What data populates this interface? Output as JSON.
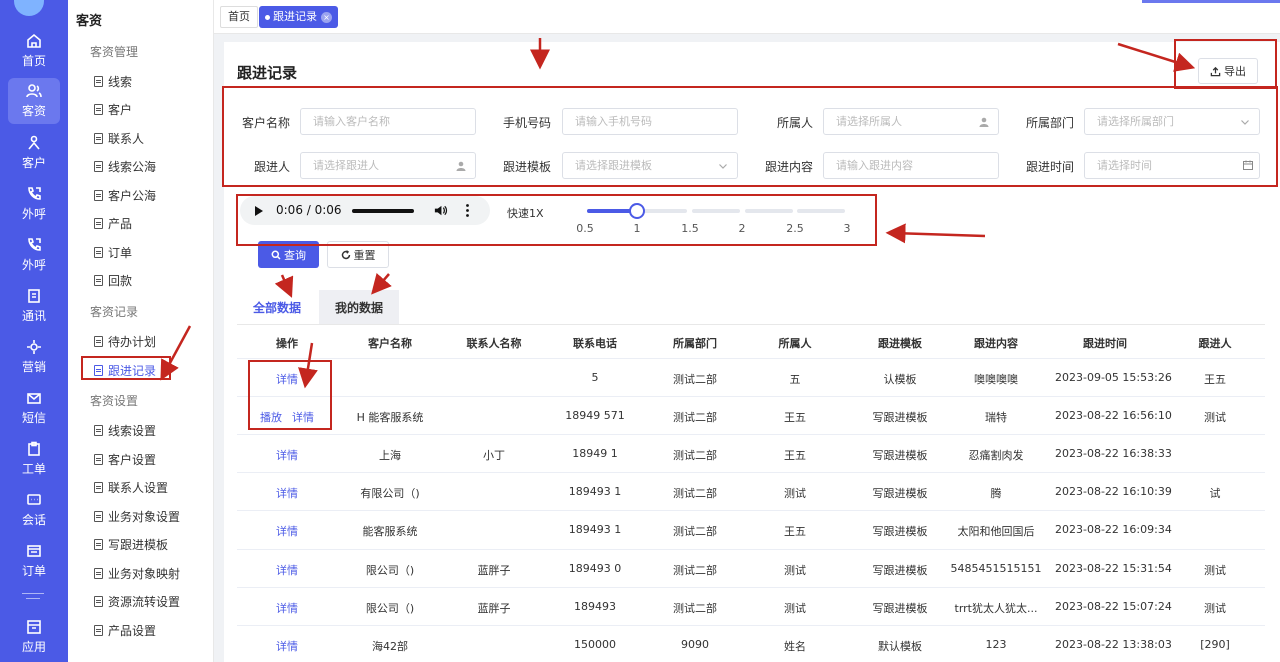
{
  "rail": {
    "items": [
      {
        "label": "首页"
      },
      {
        "label": "客资"
      },
      {
        "label": "客户"
      },
      {
        "label": "外呼"
      },
      {
        "label": "外呼"
      },
      {
        "label": "通讯"
      },
      {
        "label": "营销"
      },
      {
        "label": "短信"
      },
      {
        "label": "工单"
      },
      {
        "label": "会话"
      },
      {
        "label": "订单"
      },
      {
        "label": "应用"
      }
    ]
  },
  "submenu": {
    "title": "客资",
    "group1": "客资管理",
    "group1_items": [
      "线索",
      "客户",
      "联系人",
      "线索公海",
      "客户公海",
      "产品",
      "订单",
      "回款"
    ],
    "group2": "客资记录",
    "group2_items": [
      "待办计划",
      "跟进记录"
    ],
    "group3": "客资设置",
    "group3_items": [
      "线索设置",
      "客户设置",
      "联系人设置",
      "业务对象设置",
      "写跟进模板",
      "业务对象映射",
      "资源流转设置",
      "产品设置"
    ]
  },
  "tabs": {
    "home": "首页",
    "active": "跟进记录"
  },
  "page": {
    "title": "跟进记录",
    "export_label": "导出"
  },
  "filters": {
    "customer_name": {
      "label": "客户名称",
      "placeholder": "请输入客户名称"
    },
    "phone": {
      "label": "手机号码",
      "placeholder": "请输入手机号码"
    },
    "owner": {
      "label": "所属人",
      "placeholder": "请选择所属人"
    },
    "department": {
      "label": "所属部门",
      "placeholder": "请选择所属部门"
    },
    "follower": {
      "label": "跟进人",
      "placeholder": "请选择跟进人"
    },
    "template": {
      "label": "跟进模板",
      "placeholder": "请选择跟进模板"
    },
    "content": {
      "label": "跟进内容",
      "placeholder": "请输入跟进内容"
    },
    "time": {
      "label": "跟进时间",
      "placeholder": "请选择时间"
    }
  },
  "audio": {
    "time": "0:06 / 0:06",
    "progress": 1.0
  },
  "speed": {
    "label": "快速1X",
    "marks": [
      "0.5",
      "1",
      "1.5",
      "2",
      "2.5",
      "3"
    ],
    "value": 1
  },
  "buttons": {
    "query": "查询",
    "reset": "重置"
  },
  "data_tabs": {
    "all": "全部数据",
    "mine": "我的数据"
  },
  "table": {
    "headers": [
      "操作",
      "客户名称",
      "联系人名称",
      "联系电话",
      "所属部门",
      "所属人",
      "跟进模板",
      "跟进内容",
      "跟进时间",
      "跟进人"
    ],
    "rows": [
      {
        "actions": [
          "详情"
        ],
        "customer": "",
        "contact": "",
        "phone": "5",
        "dept": "测试二部",
        "owner": "五",
        "template": "认模板",
        "content": "噢噢噢噢",
        "time": "2023-09-05 15:53:26",
        "follower": "王五"
      },
      {
        "actions": [
          "播放",
          "详情"
        ],
        "customer": "H 能客服系统",
        "contact": "",
        "phone": "18949 571",
        "dept": "测试二部",
        "owner": "王五",
        "template": "写跟进模板",
        "content": "瑞特",
        "time": "2023-08-22 16:56:10",
        "follower": "测试"
      },
      {
        "actions": [
          "详情"
        ],
        "customer": "上海",
        "contact": "小丁",
        "phone": "18949 1",
        "dept": "测试二部",
        "owner": "王五",
        "template": "写跟进模板",
        "content": "忍痛割肉发",
        "time": "2023-08-22 16:38:33",
        "follower": ""
      },
      {
        "actions": [
          "详情"
        ],
        "customer": "有限公司（)",
        "contact": "",
        "phone": "189493 1",
        "dept": "测试二部",
        "owner": "测试",
        "template": "写跟进模板",
        "content": "腾",
        "time": "2023-08-22 16:10:39",
        "follower": "试"
      },
      {
        "actions": [
          "详情"
        ],
        "customer": "能客服系统",
        "contact": "",
        "phone": "189493 1",
        "dept": "测试二部",
        "owner": "王五",
        "template": "写跟进模板",
        "content": "太阳和他回国后",
        "time": "2023-08-22 16:09:34",
        "follower": ""
      },
      {
        "actions": [
          "详情"
        ],
        "customer": "限公司（)",
        "contact": "蓝胖子",
        "phone": "189493 0",
        "dept": "测试二部",
        "owner": "测试",
        "template": "写跟进模板",
        "content": "5485451515151",
        "time": "2023-08-22 15:31:54",
        "follower": "测试"
      },
      {
        "actions": [
          "详情"
        ],
        "customer": "限公司（)",
        "contact": "蓝胖子",
        "phone": "189493",
        "dept": "测试二部",
        "owner": "测试",
        "template": "写跟进模板",
        "content": "trrt犹太人犹太...",
        "time": "2023-08-22 15:07:24",
        "follower": "测试"
      },
      {
        "actions": [
          "详情"
        ],
        "customer": "海42部",
        "contact": "",
        "phone": "150000",
        "dept": "9090",
        "owner": "姓名",
        "template": "默认模板",
        "content": "123",
        "time": "2023-08-22 13:38:03",
        "follower": "[290]"
      }
    ]
  },
  "colors": {
    "brand": "#4b5ae6",
    "annotation": "#c4261f"
  }
}
